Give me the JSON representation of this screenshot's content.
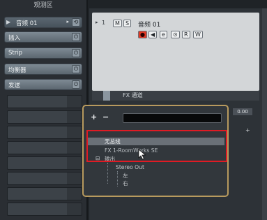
{
  "inspector": {
    "title": "观测区",
    "track_name": "音频 01",
    "track_name_icon": "play-arrow-icon",
    "track_name_arrow": "▸",
    "track_name_end": "edit-icon",
    "rows": [
      {
        "label": "插入",
        "end_icon": "power-icon"
      },
      {
        "label": "Strip",
        "end_icon": "power-icon"
      },
      {
        "label": "均衡器",
        "end_icon": "power-icon"
      },
      {
        "label": "发送",
        "end_icon": "power-icon"
      }
    ]
  },
  "track": {
    "number": "1",
    "name": "音频 01",
    "buttons_top": [
      "M",
      "S"
    ],
    "buttons_bottom": [
      "●",
      "◀",
      "e",
      "⊙",
      "R",
      "W"
    ]
  },
  "fx_channel": {
    "label": "FX 通道",
    "value": "0.00",
    "add": "+"
  },
  "popup": {
    "plus": "+",
    "minus": "−",
    "items": [
      {
        "text": "无总线"
      },
      {
        "text": "FX 1-RoomWorks SE"
      },
      {
        "text": "输出",
        "prefix": "⊟"
      },
      {
        "text": "Stereo Out"
      },
      {
        "text": "左"
      },
      {
        "text": "右"
      }
    ]
  },
  "colors": {
    "highlight": "#e01b24",
    "popup_border": "#b89a5e",
    "record": "#e23b26"
  }
}
